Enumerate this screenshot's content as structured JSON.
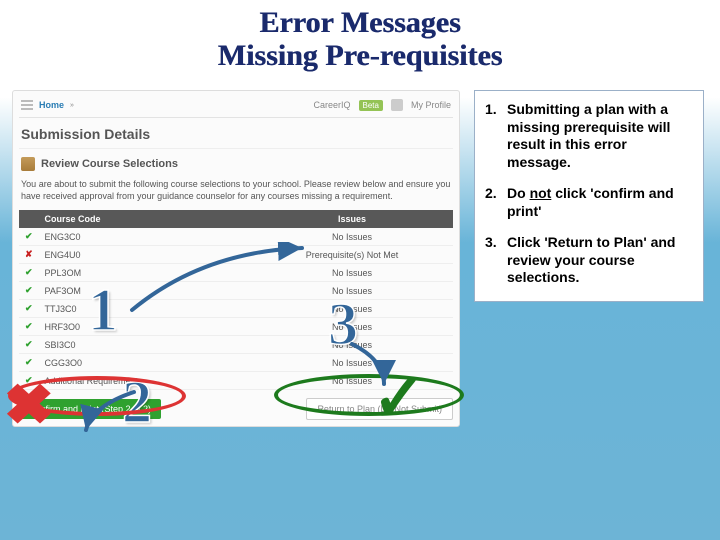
{
  "title": {
    "line1": "Error Messages",
    "line2": "Missing Pre-requisites"
  },
  "app": {
    "top": {
      "home": "Home",
      "careeriq": "CareerIQ",
      "beta": "Beta",
      "profile": "My Profile"
    },
    "section_title": "Submission Details",
    "review_title": "Review Course Selections",
    "intro": "You are about to submit the following course selections to your school. Please review below and ensure you have received approval from your guidance counselor for any courses missing a requirement.",
    "headers": {
      "code": "Course Code",
      "issues": "Issues"
    },
    "rows": [
      {
        "status": "ok",
        "code": "ENG3C0",
        "issues": "No Issues"
      },
      {
        "status": "bad",
        "code": "ENG4U0",
        "issues": "Prerequisite(s) Not Met"
      },
      {
        "status": "ok",
        "code": "PPL3OM",
        "issues": "No Issues"
      },
      {
        "status": "ok",
        "code": "PAF3OM",
        "issues": "No Issues"
      },
      {
        "status": "ok",
        "code": "TTJ3C0",
        "issues": "No Issues"
      },
      {
        "status": "ok",
        "code": "HRF3O0",
        "issues": "No Issues"
      },
      {
        "status": "ok",
        "code": "SBI3C0",
        "issues": "No Issues"
      },
      {
        "status": "ok",
        "code": "CGG3O0",
        "issues": "No Issues"
      },
      {
        "status": "ok",
        "code": "Additional Requirements",
        "issues": "No Issues"
      }
    ],
    "confirm_label": "Confirm and Print (Step 2 of 2)",
    "return_label": "Return to Plan (Do Not Submit)"
  },
  "callouts": {
    "n1": "1",
    "n2": "2",
    "n3": "3"
  },
  "notes": {
    "n1": {
      "num": "1.",
      "text": "Submitting a plan with a missing prerequisite will result in this error message."
    },
    "n2": {
      "num": "2.",
      "pre": "Do ",
      "underlined": "not",
      "post": " click 'confirm and print'"
    },
    "n3": {
      "num": "3.",
      "text": " Click 'Return to Plan' and review your course selections."
    }
  }
}
